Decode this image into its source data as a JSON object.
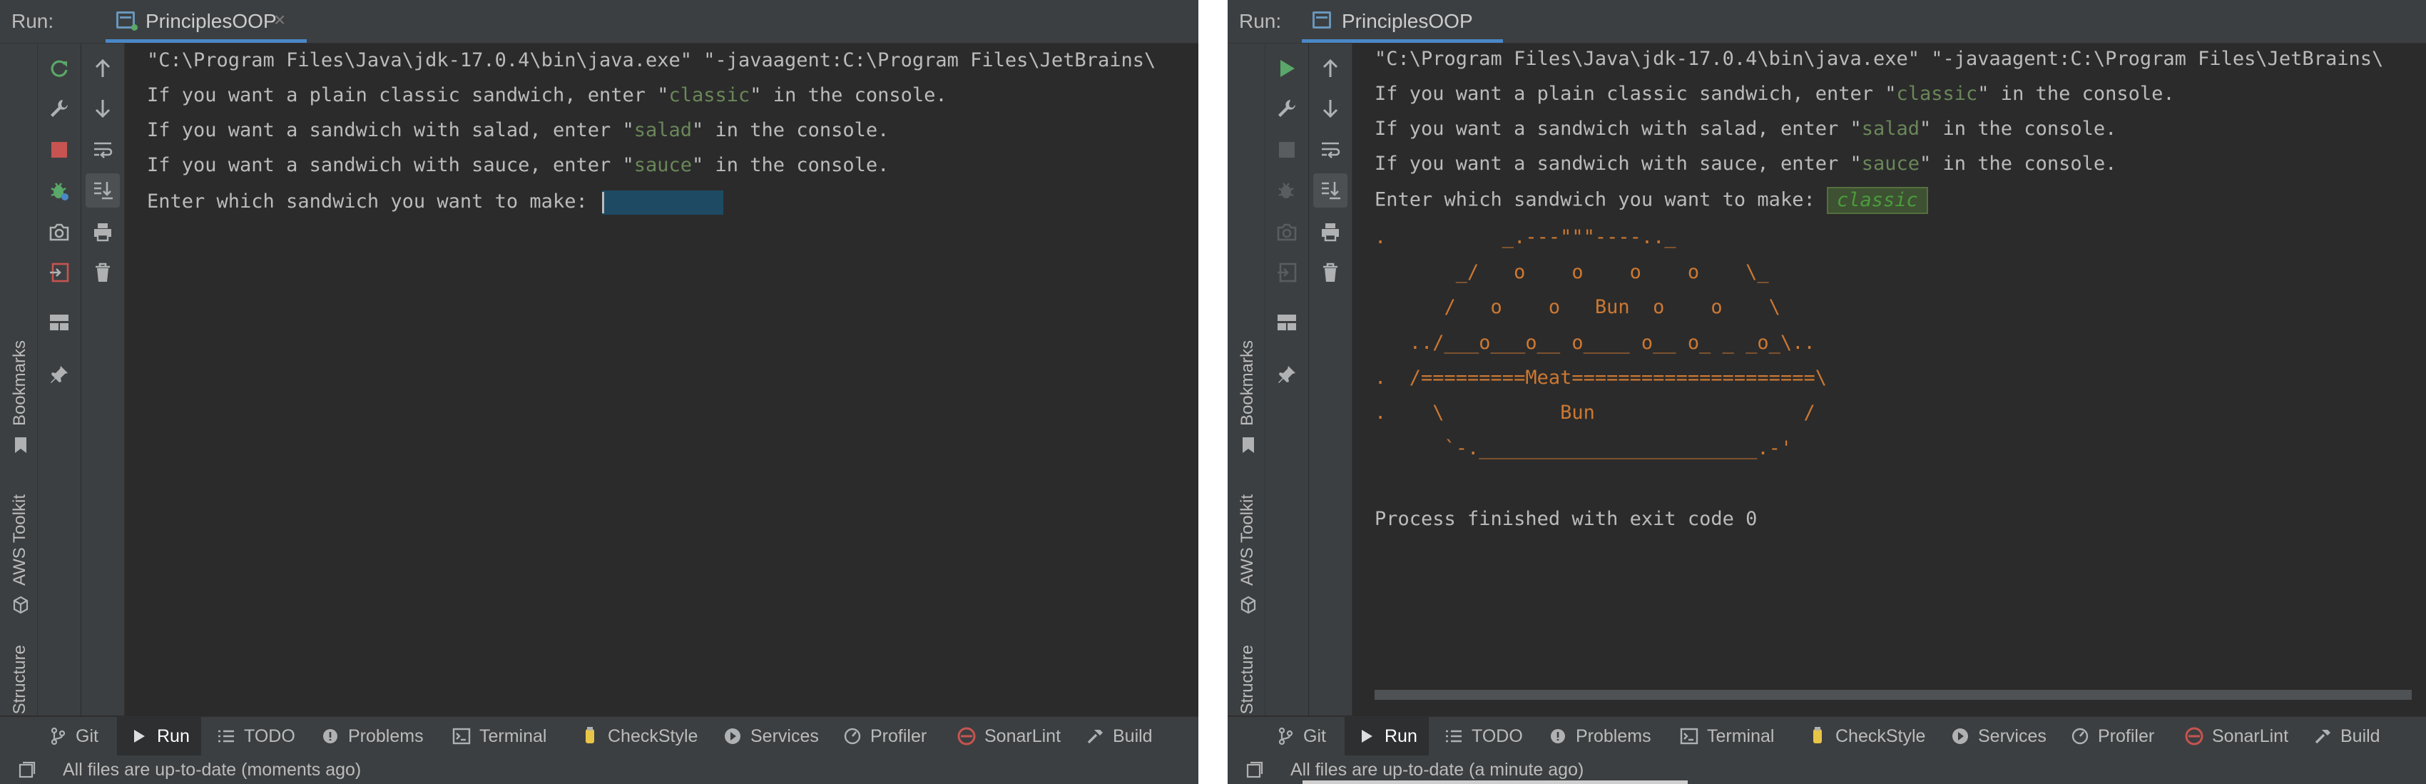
{
  "run_label": "Run:",
  "tab_title": "PrinciplesOOP",
  "tab_close": "×",
  "side_stripe": {
    "bookmarks": "Bookmarks",
    "aws_toolkit": "AWS Toolkit",
    "structure": "Structure"
  },
  "console": {
    "command": "\"C:\\Program Files\\Java\\jdk-17.0.4\\bin\\java.exe\" \"-javaagent:C:\\Program Files\\JetBrains\\",
    "line_classic": {
      "prefix": "If you want a plain classic sandwich, enter \"",
      "keyword": "classic",
      "suffix": "\" in the console."
    },
    "line_salad": {
      "prefix": "If you want a sandwich with salad, enter \"",
      "keyword": "salad",
      "suffix": "\" in the console."
    },
    "line_sauce": {
      "prefix": "If you want a sandwich with sauce, enter \"",
      "keyword": "sauce",
      "suffix": "\" in the console."
    },
    "prompt": "Enter which sandwich you want to make: ",
    "entered_value": "classic",
    "ascii_art": [
      ".          _.---\"\"\"----.._",
      "       _/   o    o    o    o    \\_",
      "      /   o    o   Bun  o    o    \\",
      "   ../___o___o__ o____ o__ o_ _ _o_\\..",
      ".  /=========Meat=====================\\",
      ".    \\          Bun                  /",
      "      `-.________________________.-'"
    ],
    "exit_message": "Process finished with exit code 0"
  },
  "bottom_tabs": [
    {
      "label": "Git",
      "icon": "git-branch-icon"
    },
    {
      "label": "Run",
      "icon": "play-icon"
    },
    {
      "label": "TODO",
      "icon": "list-icon"
    },
    {
      "label": "Problems",
      "icon": "problems-icon"
    },
    {
      "label": "Terminal",
      "icon": "terminal-icon"
    },
    {
      "label": "CheckStyle",
      "icon": "checkstyle-icon"
    },
    {
      "label": "Services",
      "icon": "services-icon"
    },
    {
      "label": "Profiler",
      "icon": "profiler-icon"
    },
    {
      "label": "SonarLint",
      "icon": "sonarlint-icon"
    },
    {
      "label": "Build",
      "icon": "hammer-icon"
    }
  ],
  "left_status": "All files are up-to-date (moments ago)",
  "right_status": "All files are up-to-date (a minute ago)",
  "colors": {
    "background": "#2b2b2b",
    "chrome": "#3c3f41",
    "string_green": "#6a8759",
    "ascii_orange": "#cc7832",
    "input_highlight": "#1e4b63",
    "run_green": "#59a869",
    "stop_red": "#c75450"
  }
}
